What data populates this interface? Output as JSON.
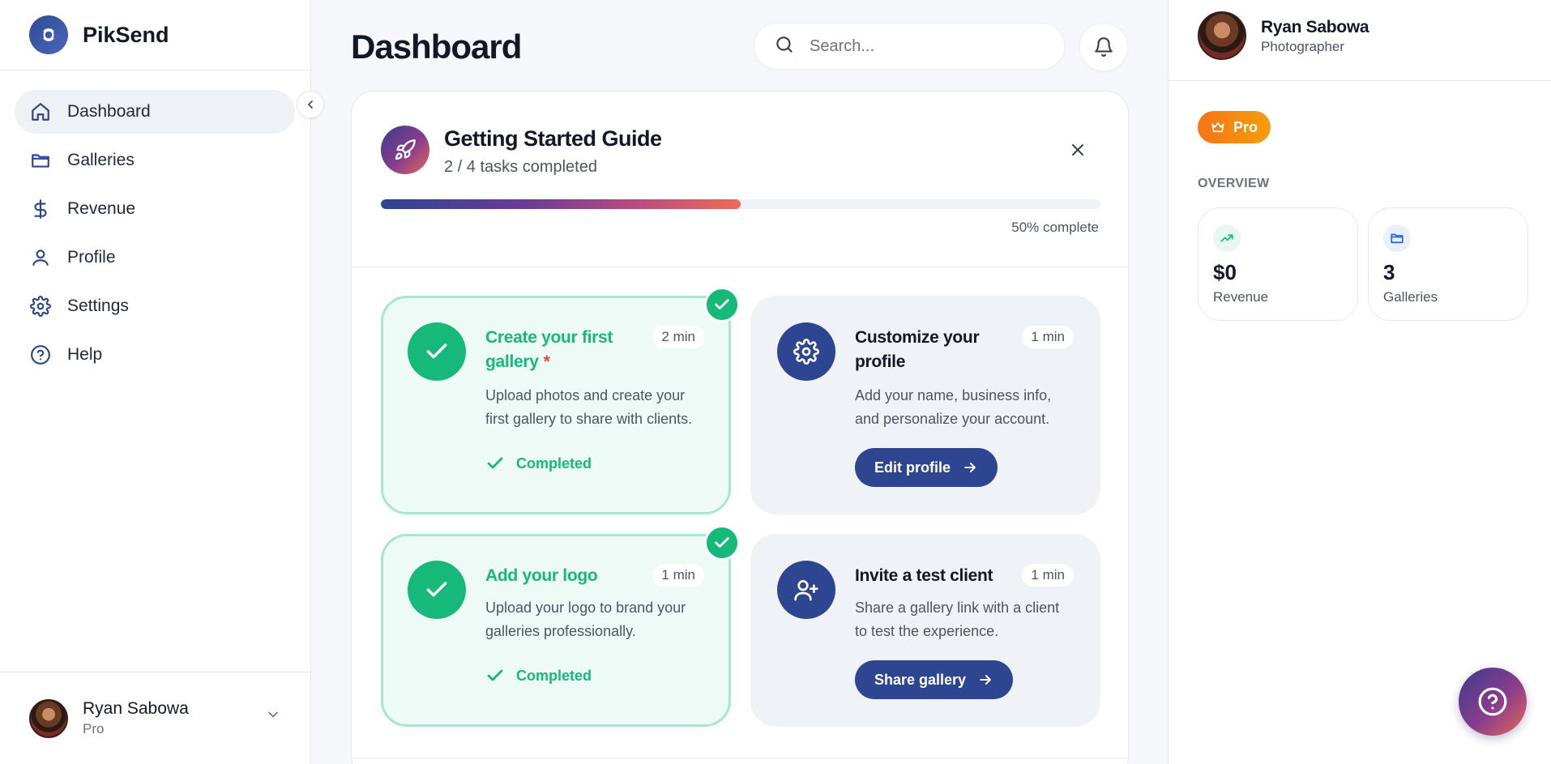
{
  "app": {
    "name": "PikSend"
  },
  "sidebar": {
    "items": [
      {
        "label": "Dashboard",
        "icon": "home-icon",
        "active": true
      },
      {
        "label": "Galleries",
        "icon": "folder-icon"
      },
      {
        "label": "Revenue",
        "icon": "dollar-icon"
      },
      {
        "label": "Profile",
        "icon": "user-icon"
      },
      {
        "label": "Settings",
        "icon": "gear-icon"
      },
      {
        "label": "Help",
        "icon": "help-circle-icon"
      }
    ],
    "user": {
      "name": "Ryan Sabowa",
      "plan": "Pro"
    }
  },
  "header": {
    "title": "Dashboard",
    "search_placeholder": "Search..."
  },
  "guide": {
    "title": "Getting Started Guide",
    "subtitle": "2 / 4 tasks completed",
    "progress": 0.5,
    "progress_text": "50% complete",
    "tasks": [
      {
        "title": "Create your first gallery",
        "required_mark": "*",
        "time": "2 min",
        "desc": "Upload photos and create your first gallery to share with clients.",
        "status": "Completed"
      },
      {
        "title": "Customize your profile",
        "time": "1 min",
        "desc": "Add your name, business info, and personalize your account.",
        "button": "Edit profile"
      },
      {
        "title": "Add your logo",
        "time": "1 min",
        "desc": "Upload your logo to brand your galleries professionally.",
        "status": "Completed"
      },
      {
        "title": "Invite a test client",
        "time": "1 min",
        "desc": "Share a gallery link with a client to test the experience.",
        "button": "Share gallery"
      }
    ]
  },
  "right_panel": {
    "user": {
      "name": "Ryan Sabowa",
      "role": "Photographer"
    },
    "plan_badge": "Pro",
    "overview_label": "OVERVIEW",
    "stats": [
      {
        "value": "$0",
        "label": "Revenue",
        "icon": "trending-up-icon"
      },
      {
        "value": "3",
        "label": "Galleries",
        "icon": "folder-icon"
      }
    ]
  },
  "colors": {
    "primary": "#2e4591",
    "success": "#16b97a",
    "pro": "#f97316"
  }
}
